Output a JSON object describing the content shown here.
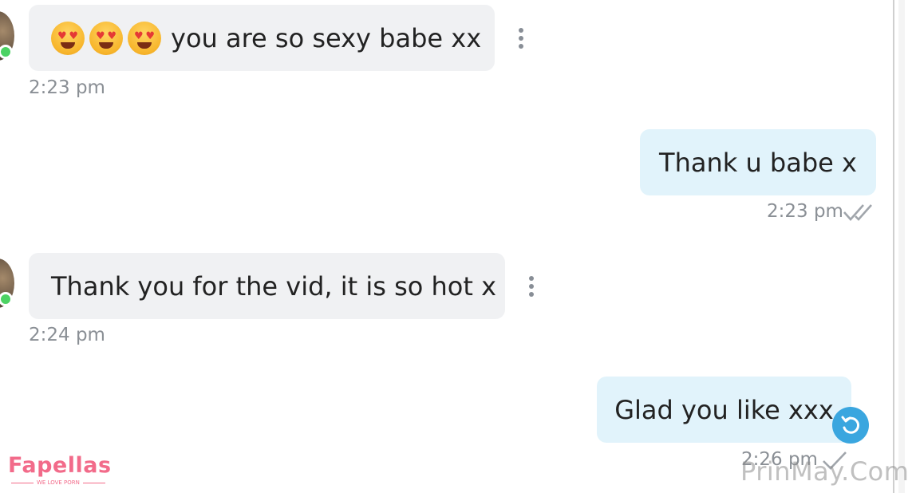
{
  "messages": [
    {
      "direction": "incoming",
      "emojis": [
        "smiling-face-with-heart-eyes",
        "smiling-face-with-heart-eyes",
        "smiling-face-with-heart-eyes"
      ],
      "text": "you are so sexy babe xx",
      "time": "2:23 pm"
    },
    {
      "direction": "outgoing",
      "text": "Thank u babe x",
      "time": "2:23 pm",
      "status": "double-check-read"
    },
    {
      "direction": "incoming",
      "text": "Thank you for the vid, it is so hot x",
      "time": "2:24 pm"
    },
    {
      "direction": "outgoing",
      "text": "Glad you like xxx",
      "time": "2:26 pm",
      "status": "single-check-sent"
    }
  ],
  "branding": {
    "logo_text": "Fapellas",
    "logo_tagline": "WE LOVE PORN",
    "watermark": "PrinMay.Com"
  },
  "colors": {
    "incoming_bubble": "#f0f1f3",
    "outgoing_bubble": "#e1f3fb",
    "online_dot": "#4cd263",
    "resend_button": "#3aa6df",
    "logo": "#f26b8a"
  },
  "icons": {
    "menu": "kebab-menu-icon",
    "read": "double-check-icon",
    "sent": "check-icon",
    "resend": "undo-arrow-icon"
  }
}
